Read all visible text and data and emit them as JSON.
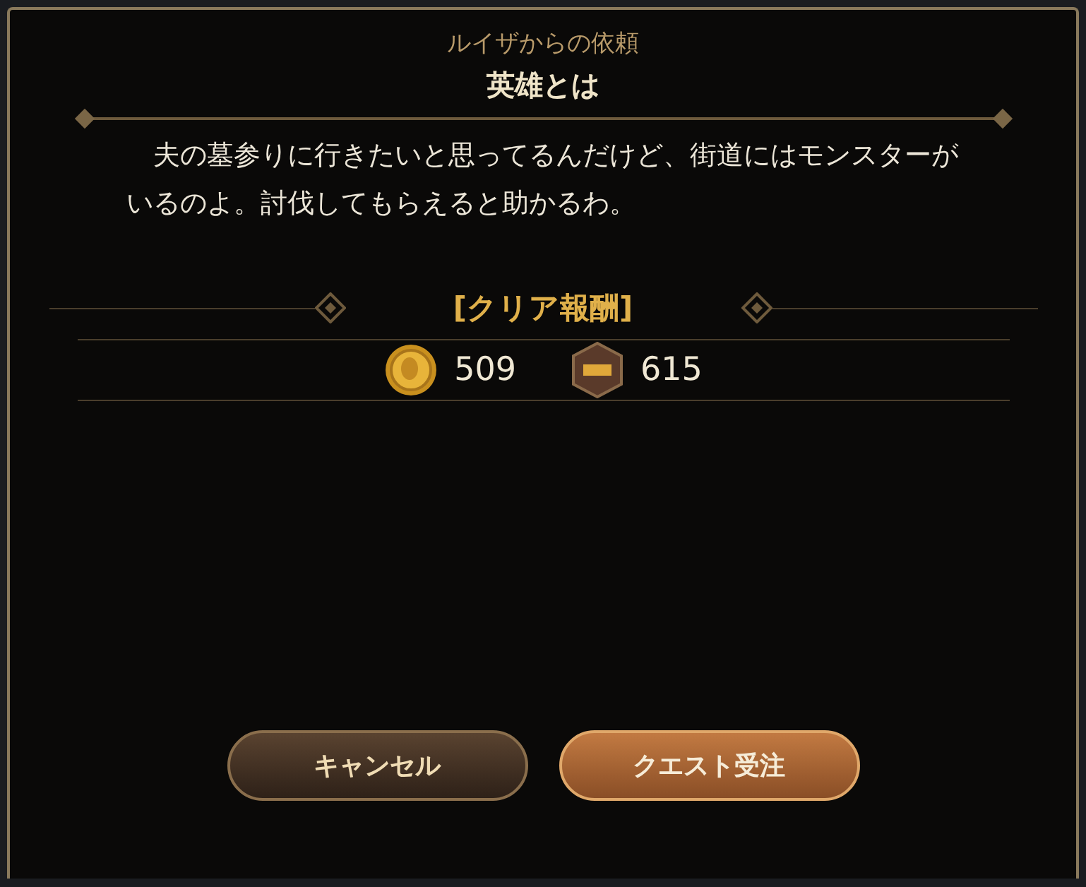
{
  "dialog": {
    "requester": "ルイザからの依頼",
    "title": "英雄とは",
    "message": "　夫の墓参りに行きたいと思ってるんだけど、街道にはモンスターがいるのよ。討伐してもらえると助かるわ。"
  },
  "rewards": {
    "heading": "[クリア報酬]",
    "items": [
      {
        "kind": "gold",
        "amount": "509"
      },
      {
        "kind": "exp",
        "amount": "615"
      }
    ]
  },
  "buttons": [
    {
      "kind": "secondary",
      "label": "キャンセル"
    },
    {
      "kind": "primary",
      "label": "クエスト受注"
    }
  ]
}
